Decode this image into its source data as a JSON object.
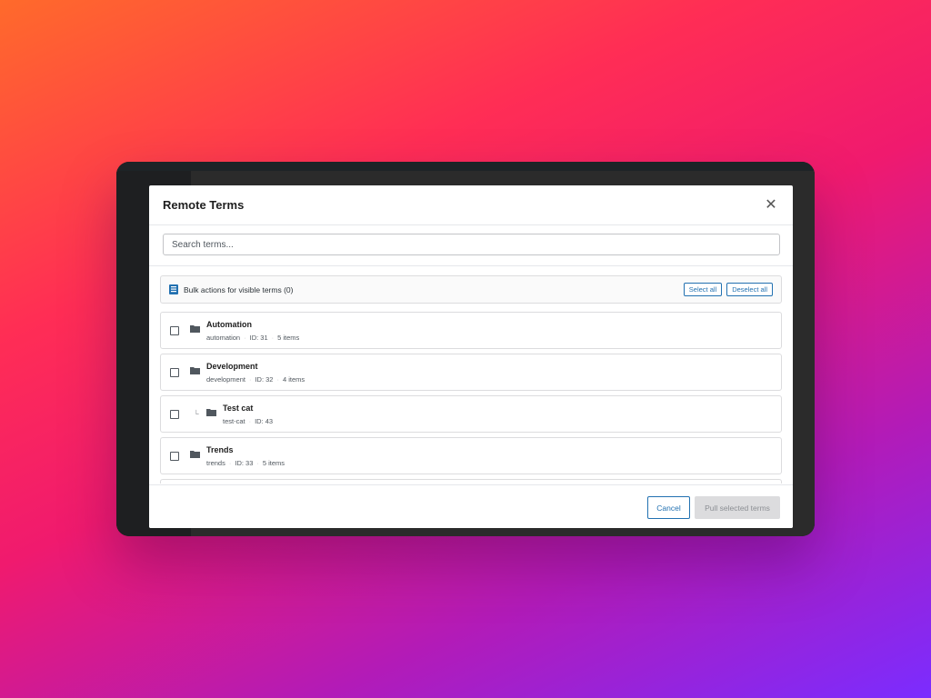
{
  "modal": {
    "title": "Remote Terms",
    "search_placeholder": "Search terms...",
    "bulk_label": "Bulk actions for visible terms (0)",
    "select_all": "Select all",
    "deselect_all": "Deselect all",
    "terms": [
      {
        "name": "Automation",
        "slug": "automation",
        "id": "ID: 31",
        "items": "5 items",
        "child": false
      },
      {
        "name": "Development",
        "slug": "development",
        "id": "ID: 32",
        "items": "4 items",
        "child": false
      },
      {
        "name": "Test cat",
        "slug": "test-cat",
        "id": "ID: 43",
        "items": "",
        "child": true
      },
      {
        "name": "Trends",
        "slug": "trends",
        "id": "ID: 33",
        "items": "5 items",
        "child": false
      }
    ],
    "cancel": "Cancel",
    "pull": "Pull selected terms"
  },
  "icons": {
    "close": "close-icon",
    "bulk": "list-icon",
    "folder": "folder-icon",
    "child": "child-arrow-icon"
  },
  "colors": {
    "accent": "#2271b1",
    "disabled_bg": "#dcdcde"
  }
}
